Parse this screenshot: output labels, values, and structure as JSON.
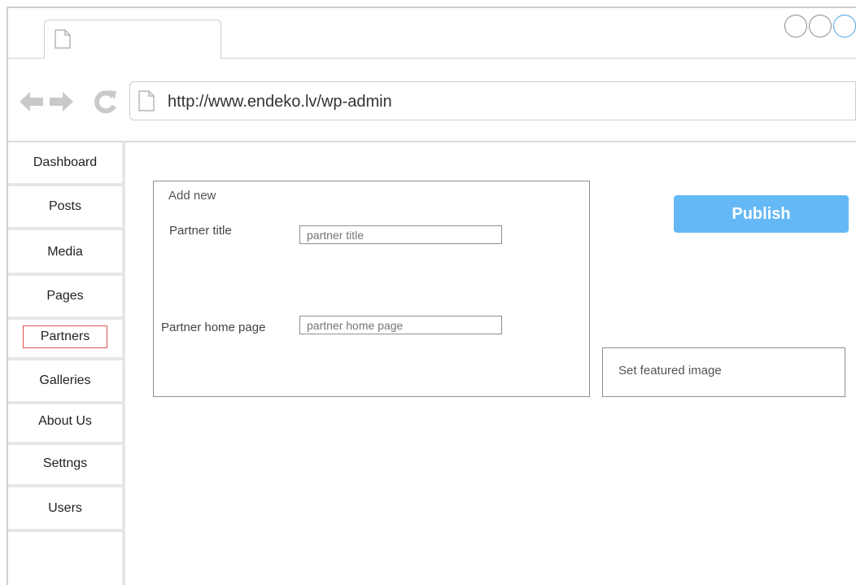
{
  "browser": {
    "url": "http://www.endeko.lv/wp-admin"
  },
  "sidebar": {
    "items": [
      {
        "label": "Dashboard"
      },
      {
        "label": "Posts"
      },
      {
        "label": "Media"
      },
      {
        "label": "Pages"
      },
      {
        "label": "Partners",
        "active": true
      },
      {
        "label": "Galleries"
      },
      {
        "label": "About Us"
      },
      {
        "label": "Settngs"
      },
      {
        "label": "Users"
      }
    ]
  },
  "form": {
    "title": "Add new",
    "partner_title": {
      "label": "Partner title",
      "placeholder": "partner title"
    },
    "partner_home_page": {
      "label": "Partner home page",
      "placeholder": "partner home page"
    }
  },
  "actions": {
    "publish_label": "Publish",
    "featured_image_label": "Set featured image"
  },
  "colors": {
    "accent": "#64b8f5",
    "active_outline": "#e05050",
    "border": "#8f8f8f"
  }
}
